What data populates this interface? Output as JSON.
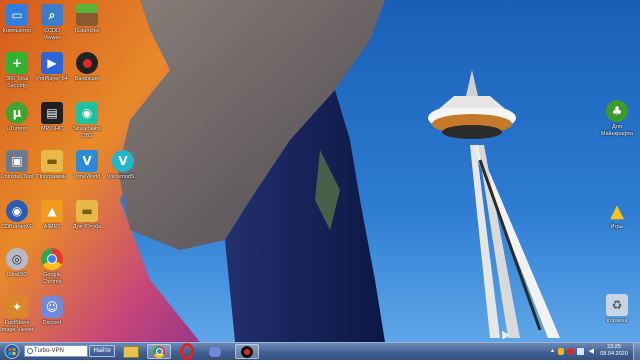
{
  "desktop": {
    "icons": [
      {
        "label": "Компьютер"
      },
      {
        "label": "CCDD Viewer"
      },
      {
        "label": "TLauncher"
      },
      {
        "label": "360 Total Security"
      },
      {
        "label": "PotPlayer 64"
      },
      {
        "label": "Bandicam"
      },
      {
        "label": "uTorrent"
      },
      {
        "label": "MPC-HC"
      },
      {
        "label": "Streamlabs OBS"
      },
      {
        "label": "Uninstall Tool"
      },
      {
        "label": "Программы"
      },
      {
        "label": "VimeWorld"
      },
      {
        "label": "VoicemodS..."
      },
      {
        "label": "CDBurnerXP"
      },
      {
        "label": "AIMP2"
      },
      {
        "label": "Для Ютуба"
      },
      {
        "label": "UltraISO"
      },
      {
        "label": "Google Chrome"
      },
      {
        "label": "FastStone Image Viewer"
      },
      {
        "label": "Discord"
      },
      {
        "label": "Для Майнкрафта"
      },
      {
        "label": "Игры"
      },
      {
        "label": "Корзина"
      }
    ]
  },
  "taskbar": {
    "search_value": "Turbo-VPN",
    "search_button": "Найти",
    "apps": [
      {
        "name": "file-explorer"
      },
      {
        "name": "google-chrome"
      },
      {
        "name": "opera"
      },
      {
        "name": "discord"
      },
      {
        "name": "bandicam"
      }
    ],
    "clock": {
      "time": "23:25",
      "date": "08.04.2020"
    }
  },
  "colors": {
    "sky": "#1f63b8",
    "taskbar": "#4a6a9e",
    "accent": "#2f7fe0"
  }
}
